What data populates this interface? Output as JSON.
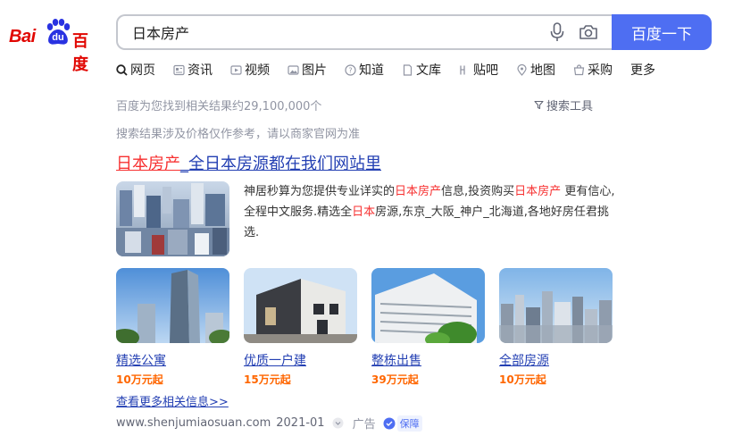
{
  "logo": {
    "text_latin": "Bai",
    "text_du": "du",
    "text_cn": "百度"
  },
  "search": {
    "query": "日本房产",
    "button_label": "百度一下"
  },
  "tabs": [
    {
      "label": "网页",
      "icon": "search-icon"
    },
    {
      "label": "资讯",
      "icon": "news-icon"
    },
    {
      "label": "视频",
      "icon": "video-icon"
    },
    {
      "label": "图片",
      "icon": "image-icon"
    },
    {
      "label": "知道",
      "icon": "question-icon"
    },
    {
      "label": "文库",
      "icon": "document-icon"
    },
    {
      "label": "贴吧",
      "icon": "tieba-icon"
    },
    {
      "label": "地图",
      "icon": "map-icon"
    },
    {
      "label": "采购",
      "icon": "cart-icon"
    },
    {
      "label": "更多",
      "icon": ""
    }
  ],
  "results_meta": {
    "count_text": "百度为您找到相关结果约29,100,000个",
    "search_tools_label": "搜索工具",
    "price_note": "搜索结果涉及价格仅作参考，请以商家官网为准"
  },
  "ad": {
    "title_highlight": "日本房产",
    "title_rest": "_全日本房源都在我们网站里",
    "desc_part1": "神居秒算为您提供专业详实的",
    "desc_hl1": "日本房产",
    "desc_part2": "信息,投资购买",
    "desc_hl2": "日本房产",
    "desc_part3": " 更有信心,全程中文服务.精选全",
    "desc_hl3": "日本",
    "desc_part4": "房源,东京_大阪_神户_北海道,各地好房任君挑选.",
    "cards": [
      {
        "title": "精选公寓",
        "price": "10万元起"
      },
      {
        "title": "优质一户建",
        "price": "15万元起"
      },
      {
        "title": "整栋出售",
        "price": "39万元起"
      },
      {
        "title": "全部房源",
        "price": "10万元起"
      }
    ],
    "more_link": "查看更多相关信息>>",
    "source_url": "www.shenjumiaosuan.com",
    "date": "2021-01",
    "ad_label": "广告",
    "guarantee_label": "保障"
  },
  "colors": {
    "brand_blue": "#4e6ef2",
    "link_blue": "#2440b3",
    "highlight_red": "#f73131",
    "price_orange": "#ff6600"
  }
}
